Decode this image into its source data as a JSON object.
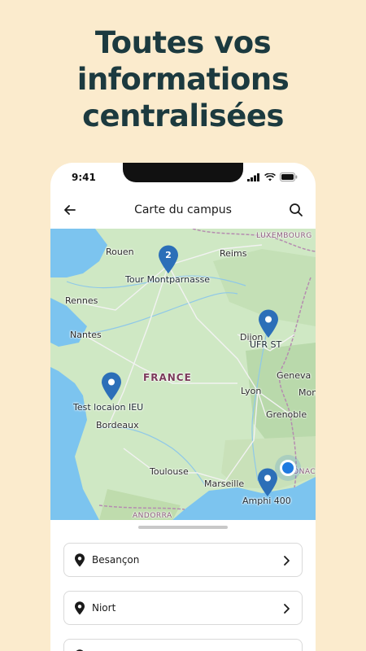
{
  "headline": {
    "line1": "Toutes vos",
    "line2": "informations",
    "line3": "centralisées"
  },
  "status_bar": {
    "time": "9:41"
  },
  "app_bar": {
    "title": "Carte du campus",
    "back_icon": "arrow-left-icon",
    "search_icon": "search-icon"
  },
  "map": {
    "places": {
      "luxembourg": "LUXEMBOURG",
      "rouen": "Rouen",
      "reims": "Reims",
      "rennes": "Rennes",
      "nantes": "Nantes",
      "dijon": "Dijon",
      "france": "FRANCE",
      "geneva": "Geneva",
      "lyon": "Lyon",
      "mont": "Mont",
      "grenoble": "Grenoble",
      "bordeaux": "Bordeaux",
      "toulouse": "Toulouse",
      "marseille": "Marseille",
      "monaco": "ONACO",
      "andorra": "ANDORRA"
    },
    "pins": {
      "cluster": {
        "count": "2",
        "label": "Tour Montparnasse"
      },
      "ufr": {
        "label": "UFR ST"
      },
      "ieu": {
        "label": "Test locaion IEU"
      },
      "amphi": {
        "label": "Amphi 400"
      }
    },
    "colors": {
      "land": "#cfe8c4",
      "water": "#7cc4ef",
      "pin": "#2c6fb8",
      "user_location": "#1f7ae0"
    }
  },
  "list": {
    "items": [
      {
        "label": "Besançon",
        "icon": "location-pin-icon"
      },
      {
        "label": "Niort",
        "icon": "location-pin-icon"
      }
    ]
  }
}
